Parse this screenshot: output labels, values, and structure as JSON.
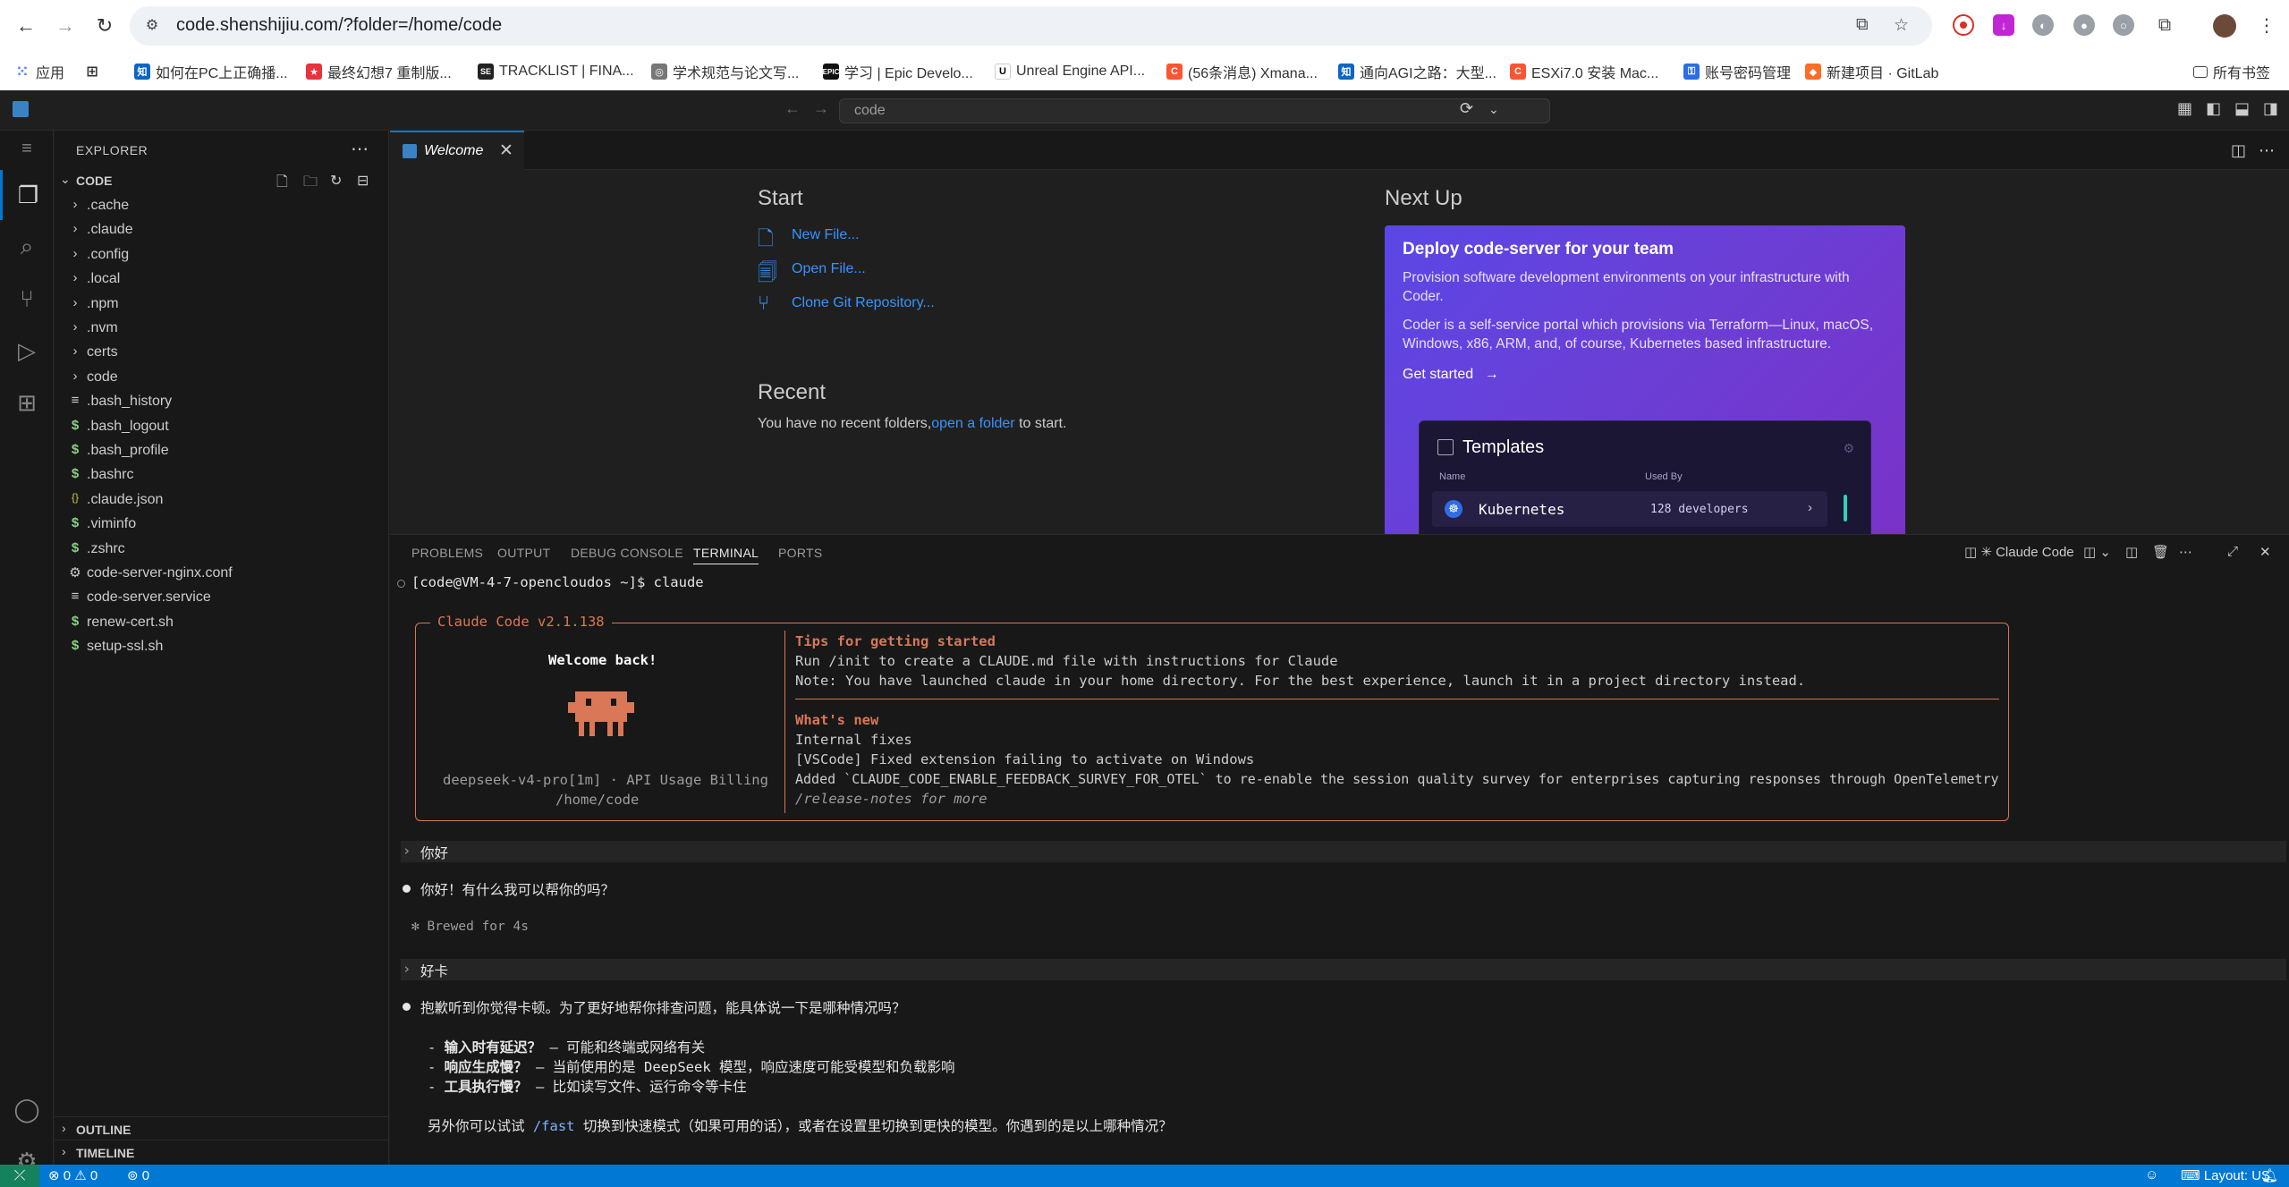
{
  "browser": {
    "url": "code.shenshijiu.com/?folder=/home/code",
    "bookmarks": [
      {
        "label": "应用",
        "color": "#4285f4"
      },
      {
        "label": "",
        "color": "#555"
      },
      {
        "label": "如何在PC上正确播...",
        "color": "#0a66c2",
        "glyph": "知"
      },
      {
        "label": "最终幻想7 重制版...",
        "color": "#e8323c"
      },
      {
        "label": "TRACKLIST | FINA...",
        "color": "#222"
      },
      {
        "label": "学术规范与论文写...",
        "color": "#666"
      },
      {
        "label": "学习 | Epic Develo...",
        "color": "#111"
      },
      {
        "label": "Unreal Engine API...",
        "color": "#fff"
      },
      {
        "label": "(56条消息) Xmana...",
        "color": "#fc5531"
      },
      {
        "label": "通向AGI之路：大型...",
        "color": "#0a66c2",
        "glyph": "知"
      },
      {
        "label": "ESXi7.0 安装 Mac...",
        "color": "#fc5531"
      },
      {
        "label": "账号密码管理",
        "color": "#2b6de5"
      },
      {
        "label": "新建项目 · GitLab",
        "color": "#fc6d26"
      }
    ],
    "all_bookmarks": "所有书签"
  },
  "vscode": {
    "command_center": "code",
    "explorer_title": "EXPLORER",
    "folder": "CODE",
    "tree": [
      {
        "name": ".cache",
        "type": "folder"
      },
      {
        "name": ".claude",
        "type": "folder"
      },
      {
        "name": ".config",
        "type": "folder"
      },
      {
        "name": ".local",
        "type": "folder"
      },
      {
        "name": ".npm",
        "type": "folder"
      },
      {
        "name": ".nvm",
        "type": "folder"
      },
      {
        "name": "certs",
        "type": "folder"
      },
      {
        "name": "code",
        "type": "folder"
      },
      {
        "name": ".bash_history",
        "type": "text"
      },
      {
        "name": ".bash_logout",
        "type": "shell"
      },
      {
        "name": ".bash_profile",
        "type": "shell"
      },
      {
        "name": ".bashrc",
        "type": "shell"
      },
      {
        "name": ".claude.json",
        "type": "json"
      },
      {
        "name": ".viminfo",
        "type": "shell"
      },
      {
        "name": ".zshrc",
        "type": "shell"
      },
      {
        "name": "code-server-nginx.conf",
        "type": "gear"
      },
      {
        "name": "code-server.service",
        "type": "text"
      },
      {
        "name": "renew-cert.sh",
        "type": "shell"
      },
      {
        "name": "setup-ssl.sh",
        "type": "shell"
      }
    ],
    "outline": "OUTLINE",
    "timeline": "TIMELINE",
    "tab": "Welcome",
    "welcome": {
      "start": "Start",
      "new_file": "New File...",
      "open_file": "Open File...",
      "clone": "Clone Git Repository...",
      "recent": "Recent",
      "recent_prefix": "You have no recent folders,",
      "recent_link": "open a folder",
      "recent_suffix": "to start.",
      "next_up": "Next Up",
      "card_title": "Deploy code-server for your team",
      "card_p1": "Provision software development environments on your infrastructure with Coder.",
      "card_p2": "Coder is a self-service portal which provisions via Terraform—Linux, macOS, Windows, x86, ARM, and, of course, Kubernetes based infrastructure.",
      "card_link": "Get started",
      "tpl_title": "Templates",
      "tpl_col1": "Name",
      "tpl_col2": "Used By",
      "tpl_row_name": "Kubernetes",
      "tpl_row_count": "128 developers"
    },
    "panel_tabs": [
      "PROBLEMS",
      "OUTPUT",
      "DEBUG CONSOLE",
      "TERMINAL",
      "PORTS"
    ],
    "terminal_name": "✳ Claude Code",
    "terminal": {
      "prompt": "[code@VM-4-7-opencloudos ~]$ claude",
      "box_title": "Claude Code v2.1.138",
      "welcome_back": "Welcome back!",
      "model": "deepseek-v4-pro[1m] · API Usage Billing",
      "cwd": "/home/code",
      "tips_title": "Tips for getting started",
      "tip1": "Run /init to create a CLAUDE.md file with instructions for Claude",
      "tip2": "Note: You have launched claude in your home directory. For the best experience, launch it in a project directory instead.",
      "whats_new": "What's new",
      "new1": "Internal fixes",
      "new2": "[VSCode] Fixed extension failing to activate on Windows",
      "new3": "Added `CLAUDE_CODE_ENABLE_FEEDBACK_SURVEY_FOR_OTEL` to re-enable the session quality survey for enterprises capturing responses through OpenTelemetry",
      "new4": "/release-notes for more",
      "user1": "你好",
      "reply1": "你好！有什么我可以帮你的吗？",
      "brewed": "✻ Brewed for 4s",
      "user2": "好卡",
      "reply2": "抱歉听到你觉得卡顿。为了更好地帮你排查问题，能具体说一下是哪种情况吗？",
      "b1_bold": "输入时有延迟？",
      "b1_rest": " — 可能和终端或网络有关",
      "b2_bold": "响应生成慢？",
      "b2_rest": " — 当前使用的是 DeepSeek 模型，响应速度可能受模型和负载影响",
      "b3_bold": "工具执行慢？",
      "b3_rest": " — 比如读写文件、运行命令等卡住",
      "last_pre": "另外你可以试试 ",
      "last_cmd": "/fast",
      "last_post": " 切换到快速模式（如果可用的话），或者在设置里切换到更快的模型。你遇到的是以上哪种情况？"
    },
    "status": {
      "errors": "0",
      "warnings": "0",
      "ports": "0",
      "layout": "Layout: US"
    }
  }
}
